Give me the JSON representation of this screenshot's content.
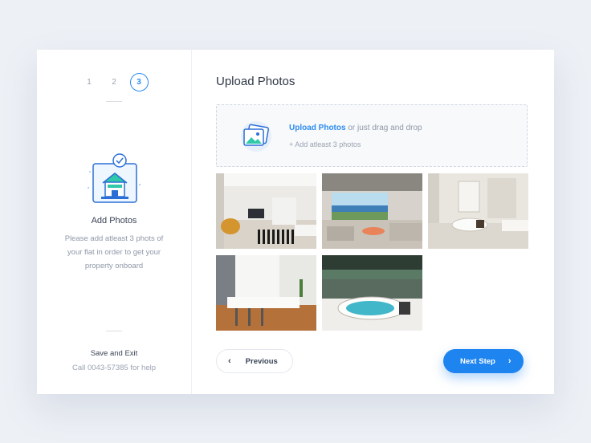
{
  "stepper": {
    "steps": [
      "1",
      "2",
      "3"
    ],
    "active": "3"
  },
  "sidebar": {
    "title": "Add Photos",
    "description": "Please add atleast 3 phots of your flat in order to get your property onboard",
    "save_exit": "Save and Exit",
    "help": "Call 0043-57385 for help",
    "illustration_icon": "house-photo-check-icon"
  },
  "main": {
    "title": "Upload Photos",
    "dropzone": {
      "icon": "photos-icon",
      "link": "Upload Photos",
      "text": " or just drag and drop",
      "hint": "+ Add atleast 3 photos"
    },
    "photos": [
      "living-room-photo",
      "lounge-photo",
      "bathroom-photo",
      "kitchen-photo",
      "jacuzzi-photo"
    ]
  },
  "footer": {
    "previous_label": "Previous",
    "next_label": "Next Step"
  },
  "colors": {
    "accent": "#1d84f0",
    "background": "#edf0f5"
  }
}
